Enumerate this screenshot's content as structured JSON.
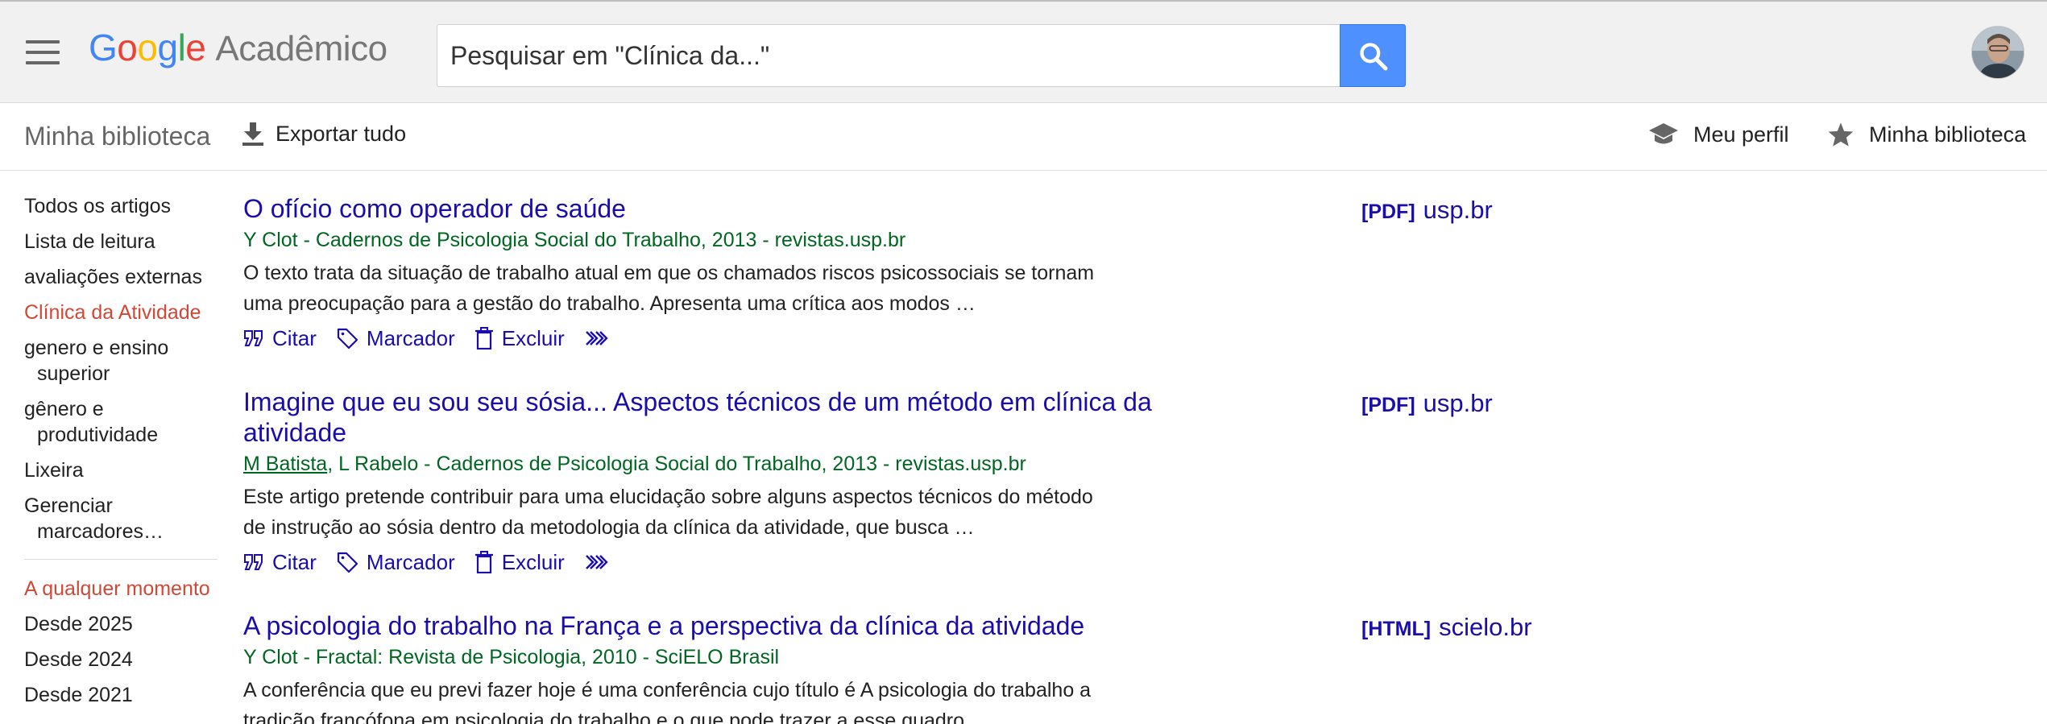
{
  "header": {
    "menu_icon": "hamburger-menu-icon",
    "logo": {
      "letters": [
        "G",
        "o",
        "o",
        "g",
        "l",
        "e"
      ],
      "product": "Acadêmico"
    },
    "search": {
      "placeholder": "Pesquisar em \"Clínica da...\"",
      "value": ""
    },
    "search_icon": "search-icon",
    "avatar_icon": "avatar"
  },
  "toolbar": {
    "library_title": "Minha biblioteca",
    "export_label": "Exportar tudo",
    "profile_label": "Meu perfil",
    "my_library_label": "Minha biblioteca"
  },
  "sidebar": {
    "labels": [
      "Todos os artigos",
      "Lista de leitura",
      "avaliações externas",
      "Clínica da Atividade",
      "genero e ensino superior",
      "gênero e produtividade",
      "Lixeira",
      "Gerenciar marcadores…"
    ],
    "time_filters": [
      "A qualquer momento",
      "Desde 2025",
      "Desde 2024",
      "Desde 2021"
    ]
  },
  "results": [
    {
      "title": "O ofício como operador de saúde",
      "meta": "Y Clot - Cadernos de Psicologia Social do Trabalho, 2013 - revistas.usp.br",
      "snippet": "O texto trata da situação de trabalho atual em que os chamados riscos psicossociais se tornam uma preocupação para a gestão do trabalho. Apresenta uma crítica aos modos …",
      "format": "[PDF]",
      "source": "usp.br"
    },
    {
      "title": "Imagine que eu sou seu sósia... Aspectos técnicos de um método em clínica da atividade",
      "meta_author_link": "M Batista",
      "meta_rest": ", L Rabelo - Cadernos de Psicologia Social do Trabalho, 2013 - revistas.usp.br",
      "snippet": "Este artigo pretende contribuir para uma elucidação sobre alguns aspectos técnicos do método de instrução ao sósia dentro da metodologia da clínica da atividade, que busca …",
      "format": "[PDF]",
      "source": "usp.br"
    },
    {
      "title": "A psicologia do trabalho na França e a perspectiva da clínica da atividade",
      "meta": "Y Clot - Fractal: Revista de Psicologia, 2010 - SciELO Brasil",
      "snippet": "A conferência que eu previ fazer hoje é uma conferência cujo título é A psicologia do trabalho a tradição francófona em psicologia do trabalho e o que pode trazer a esse quadro …",
      "format": "[HTML]",
      "source": "scielo.br"
    }
  ],
  "actions": {
    "cite": "Citar",
    "label": "Marcador",
    "delete": "Excluir"
  },
  "colors": {
    "link": "#1a0dab",
    "meta_green": "#006621",
    "active_red": "#d14836",
    "search_blue": "#4d90fe"
  }
}
